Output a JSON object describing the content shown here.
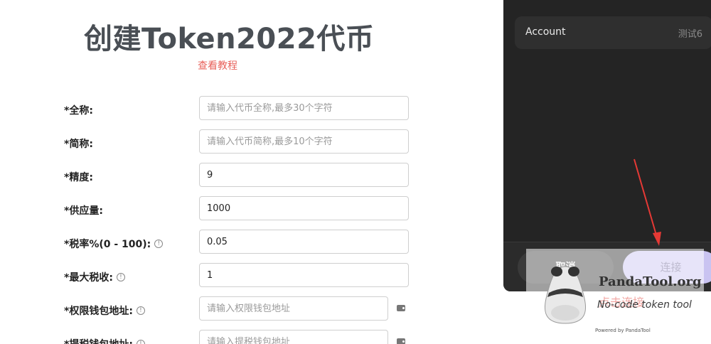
{
  "header": {
    "title": "创建Token2022代币",
    "tutorial_link": "查看教程"
  },
  "form": {
    "fields": [
      {
        "label": "*全称:",
        "value": "",
        "placeholder": "请输入代币全称,最多30个字符",
        "has_info": false,
        "has_wallet": false
      },
      {
        "label": "*简称:",
        "value": "",
        "placeholder": "请输入代币简称,最多10个字符",
        "has_info": false,
        "has_wallet": false
      },
      {
        "label": "*精度:",
        "value": "9",
        "placeholder": "",
        "has_info": false,
        "has_wallet": false
      },
      {
        "label": "*供应量:",
        "value": "1000",
        "placeholder": "",
        "has_info": false,
        "has_wallet": false
      },
      {
        "label": "*税率%(0 - 100):",
        "value": "0.05",
        "placeholder": "",
        "has_info": true,
        "has_wallet": false
      },
      {
        "label": "*最大税收:",
        "value": "1",
        "placeholder": "",
        "has_info": true,
        "has_wallet": false
      },
      {
        "label": "*权限钱包地址:",
        "value": "",
        "placeholder": "请输入权限钱包地址",
        "has_info": true,
        "has_wallet": true
      },
      {
        "label": "*提税钱包地址:",
        "value": "",
        "placeholder": "请输入提税钱包地址",
        "has_info": true,
        "has_wallet": true
      }
    ],
    "info_glyph": "!",
    "icons": {
      "info": "info-circle-icon",
      "wallet": "wallet-icon"
    }
  },
  "wallet_popup": {
    "account_label": "Account",
    "account_value": "测试6",
    "cancel_label": "取消",
    "connect_label": "连接"
  },
  "watermark": {
    "brand": "PandaTool.org",
    "tagline": "No-code token tool",
    "click_hint": "点击连接",
    "powered": "Powered by PandaTool"
  },
  "colors": {
    "accent_link": "#e8605a",
    "panel_bg": "#242424",
    "connect_button": "#c9c3f1",
    "arrow": "#e53935"
  }
}
